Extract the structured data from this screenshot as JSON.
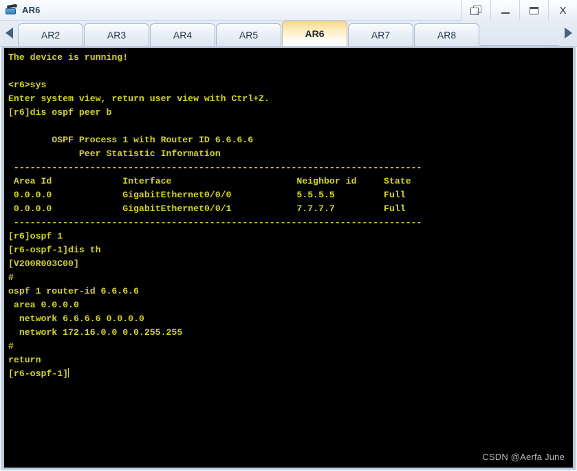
{
  "window": {
    "title": "AR6",
    "icon": "router-icon",
    "controls": [
      {
        "name": "restore-button",
        "icon": "restore-windows-icon",
        "label": ""
      },
      {
        "name": "minimize-button",
        "icon": "minimize-icon",
        "label": ""
      },
      {
        "name": "maximize-button",
        "icon": "maximize-icon",
        "label": ""
      },
      {
        "name": "close-button",
        "icon": "close-icon",
        "label": "X"
      }
    ]
  },
  "tabbar": {
    "scroll_left_icon": "triangle-left-icon",
    "scroll_right_icon": "triangle-right-icon",
    "active_tab": "AR6",
    "tabs": [
      {
        "label": "AR2"
      },
      {
        "label": "AR3"
      },
      {
        "label": "AR4"
      },
      {
        "label": "AR5"
      },
      {
        "label": "AR6"
      },
      {
        "label": "AR7"
      },
      {
        "label": "AR8"
      }
    ]
  },
  "terminal": {
    "foreground_color": "#d6d600",
    "background_color": "#000000",
    "prompt_current": "[r6-ospf-1]",
    "lines": [
      "The device is running!",
      "",
      "<r6>sys",
      "Enter system view, return user view with Ctrl+Z.",
      "[r6]dis ospf peer b",
      "",
      "        OSPF Process 1 with Router ID 6.6.6.6",
      "             Peer Statistic Information",
      " ---------------------------------------------------------------------------",
      " Area Id             Interface                       Neighbor id     State",
      " 0.0.0.0             GigabitEthernet0/0/0            5.5.5.5         Full",
      " 0.0.0.0             GigabitEthernet0/0/1            7.7.7.7         Full",
      " ---------------------------------------------------------------------------",
      "[r6]ospf 1",
      "[r6-ospf-1]dis th",
      "[V200R003C00]",
      "#",
      "ospf 1 router-id 6.6.6.6",
      " area 0.0.0.0",
      "  network 6.6.6.6 0.0.0.0",
      "  network 172.16.0.0 0.0.255.255",
      "#",
      "return"
    ],
    "ospf_table": {
      "title": "OSPF Process 1 with Router ID 6.6.6.6",
      "subtitle": "Peer Statistic Information",
      "columns": [
        "Area Id",
        "Interface",
        "Neighbor id",
        "State"
      ],
      "rows": [
        [
          "0.0.0.0",
          "GigabitEthernet0/0/0",
          "5.5.5.5",
          "Full"
        ],
        [
          "0.0.0.0",
          "GigabitEthernet0/0/1",
          "7.7.7.7",
          "Full"
        ]
      ]
    },
    "config": {
      "version": "[V200R003C00]",
      "process": "ospf 1 router-id 6.6.6.6",
      "area": "area 0.0.0.0",
      "networks": [
        "network 6.6.6.6 0.0.0.0",
        "network 172.16.0.0 0.0.255.255"
      ],
      "end": "return"
    }
  },
  "watermark": {
    "text": "CSDN @Aerfa June"
  }
}
